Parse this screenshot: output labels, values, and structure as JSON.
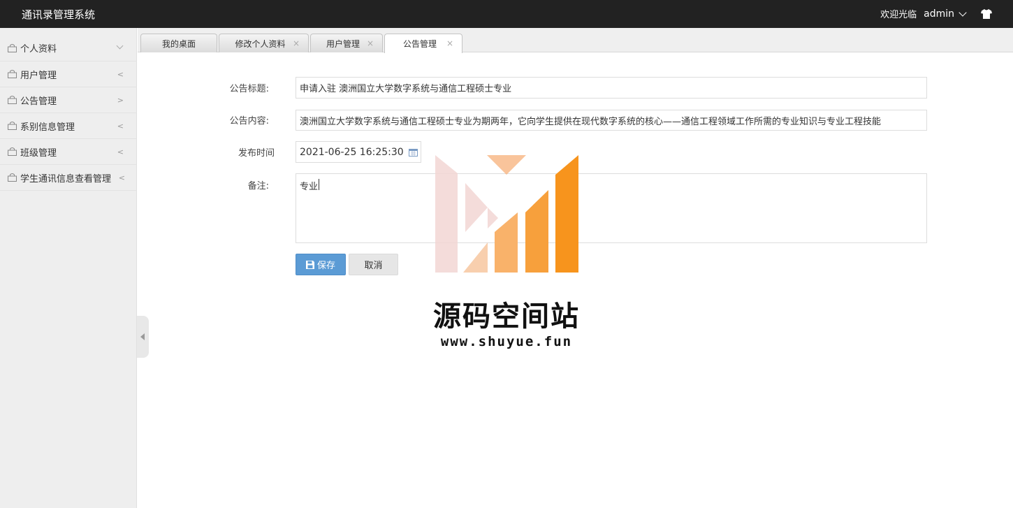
{
  "header": {
    "app_title": "通讯录管理系统",
    "welcome": "欢迎光临",
    "user": "admin"
  },
  "sidebar": {
    "items": [
      {
        "label": "个人资料",
        "arrow": "v"
      },
      {
        "label": "用户管理",
        "arrow": "<"
      },
      {
        "label": "公告管理",
        "arrow": ">"
      },
      {
        "label": "系别信息管理",
        "arrow": "<"
      },
      {
        "label": "班级管理",
        "arrow": "<"
      },
      {
        "label": "学生通讯信息查看管理",
        "arrow": "<"
      }
    ]
  },
  "tabs": [
    {
      "label": "我的桌面",
      "closable": false,
      "active": false
    },
    {
      "label": "修改个人资料",
      "closable": true,
      "active": false
    },
    {
      "label": "用户管理",
      "closable": true,
      "active": false
    },
    {
      "label": "公告管理",
      "closable": true,
      "active": true
    }
  ],
  "tab_close": "×",
  "form": {
    "title_label": "公告标题:",
    "title_value": "申请入驻 澳洲国立大学数字系统与通信工程硕士专业",
    "content_label": "公告内容:",
    "content_value": "澳洲国立大学数字系统与通信工程硕士专业为期两年，它向学生提供在现代数字系统的核心——通信工程领域工作所需的专业知识与专业工程技能",
    "time_label": "发布时间",
    "time_value": "2021-06-25 16:25:30",
    "note_label": "备注:",
    "note_value": "专业",
    "save_label": "保存",
    "cancel_label": "取消"
  },
  "watermark": {
    "text": "源码空间站",
    "url": "www.shuyue.fun"
  },
  "colors": {
    "header_bg": "#222222",
    "sidebar_bg": "#eeeeee",
    "save_btn": "#5b9bd5",
    "watermark_orange": "#f7941d"
  }
}
